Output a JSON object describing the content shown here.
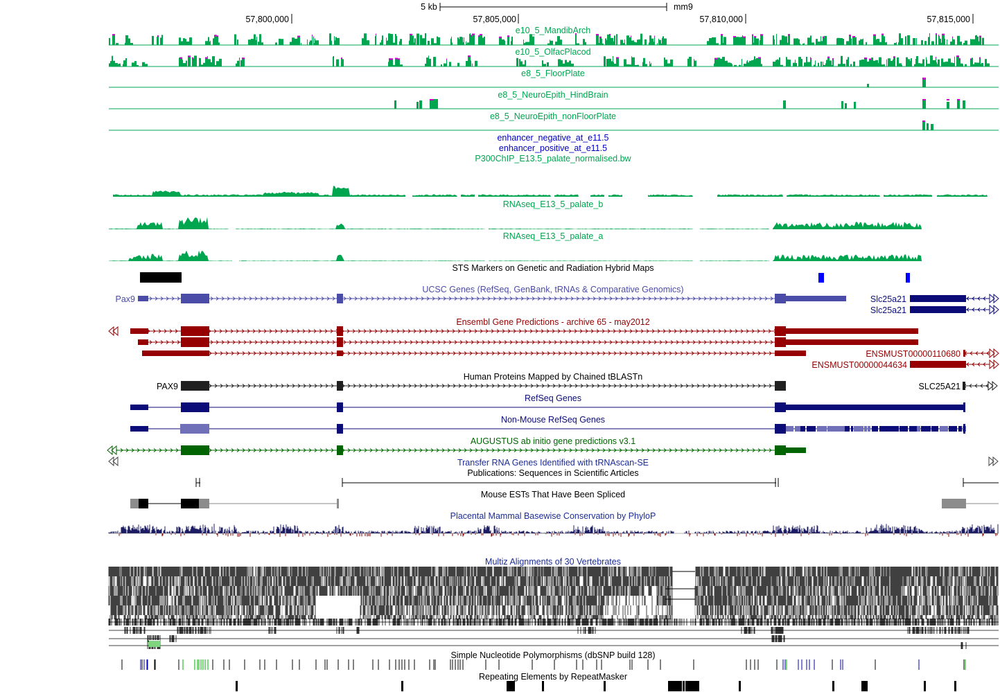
{
  "ruler": {
    "scale_label": "5 kb",
    "assembly": "mm9",
    "ticks": [
      "57,800,000",
      "57,805,000",
      "57,810,000",
      "57,815,000"
    ]
  },
  "colors": {
    "green": "#00a550",
    "magenta": "#d000d0",
    "blue_label": "#0000c0",
    "ucsc_gene": "#4b4ba8",
    "ensembl": "#960000",
    "refseq": "#0c0c78",
    "nonmouse": "#7070b8",
    "augustus": "#006400",
    "trna": "#1c2c96",
    "phylop": "#1c1c64",
    "phylop_neg": "#8b0000",
    "sts_blue": "#0000ff",
    "black": "#000000"
  },
  "tracks": [
    {
      "id": "e10_mandib",
      "label": "e10_5_MandibArch",
      "color": "green"
    },
    {
      "id": "e10_olfac",
      "label": "e10_5_OlfacPlacod",
      "color": "green"
    },
    {
      "id": "e8_floor",
      "label": "e8_5_FloorPlate",
      "color": "green"
    },
    {
      "id": "e8_hind",
      "label": "e8_5_NeuroEpith_HindBrain",
      "color": "green"
    },
    {
      "id": "e8_nonfloor",
      "label": "e8_5_NeuroEpith_nonFloorPlate",
      "color": "green"
    },
    {
      "id": "enh_neg",
      "label": "enhancer_negative_at_e11.5",
      "color": "blue_label"
    },
    {
      "id": "enh_pos",
      "label": "enhancer_positive_at_e11.5",
      "color": "blue_label"
    },
    {
      "id": "p300",
      "label": "P300ChIP_E13.5_palate_normalised.bw",
      "color": "green"
    },
    {
      "id": "rnaseq_b",
      "label": "RNAseq_E13_5_palate_b",
      "color": "green"
    },
    {
      "id": "rnaseq_a",
      "label": "RNAseq_E13_5_palate_a",
      "color": "green"
    },
    {
      "id": "sts",
      "label": "STS Markers on Genetic and Radiation Hybrid Maps",
      "color": "black"
    },
    {
      "id": "ucsc",
      "label": "UCSC Genes (RefSeq, GenBank, tRNAs & Comparative Genomics)",
      "color": "ucsc_gene"
    },
    {
      "id": "ensembl",
      "label": "Ensembl Gene Predictions - archive 65 - may2012",
      "color": "ensembl"
    },
    {
      "id": "hprot",
      "label": "Human Proteins Mapped by Chained tBLASTn",
      "color": "black"
    },
    {
      "id": "refseq",
      "label": "RefSeq Genes",
      "color": "refseq"
    },
    {
      "id": "nonmouse",
      "label": "Non-Mouse RefSeq Genes",
      "color": "refseq"
    },
    {
      "id": "augustus",
      "label": "AUGUSTUS ab initio gene predictions v3.1",
      "color": "augustus"
    },
    {
      "id": "trna",
      "label": "Transfer RNA Genes Identified with tRNAscan-SE",
      "color": "trna"
    },
    {
      "id": "pubs",
      "label": "Publications: Sequences in Scientific Articles",
      "color": "black"
    },
    {
      "id": "ests",
      "label": "Mouse ESTs That Have Been Spliced",
      "color": "black"
    },
    {
      "id": "phylop",
      "label": "Placental Mammal Basewise Conservation by PhyloP",
      "color": "trna"
    },
    {
      "id": "multiz",
      "label": "Multiz Alignments of 30 Vertebrates",
      "color": "trna"
    },
    {
      "id": "snp",
      "label": "Simple Nucleotide Polymorphisms (dbSNP build 128)",
      "color": "black"
    },
    {
      "id": "rmsk",
      "label": "Repeating Elements by RepeatMasker",
      "color": "black"
    }
  ],
  "gene_names": {
    "pax9_ucsc": "Pax9",
    "slc_1": "Slc25a21",
    "slc_2": "Slc25a21",
    "ens_1": "ENSMUST00000110680",
    "ens_2": "ENSMUST00000044634",
    "pax9_hp": "PAX9",
    "slc_hp": "SLC25A21"
  }
}
